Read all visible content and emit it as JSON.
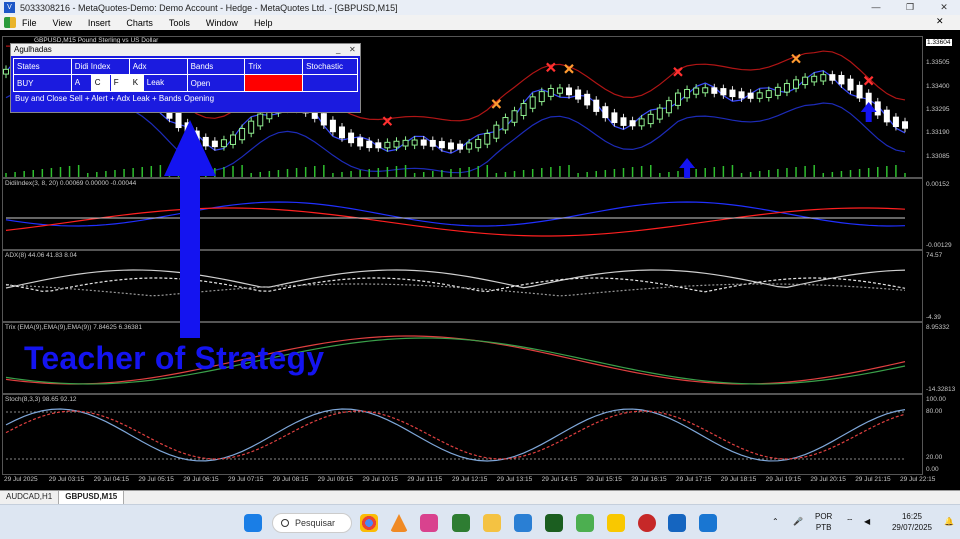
{
  "window": {
    "title": "5033308216 - MetaQuotes-Demo: Demo Account - Hedge - MetaQuotes Ltd. - [GBPUSD,M15]"
  },
  "menu": [
    "File",
    "View",
    "Insert",
    "Charts",
    "Tools",
    "Window",
    "Help"
  ],
  "panel": {
    "title": "Agulhadas",
    "headers": [
      "States",
      "Didi Index",
      "Adx",
      "Bands",
      "Trix",
      "Stochastic"
    ],
    "row": {
      "state": "BUY",
      "didi": [
        "A",
        "C",
        "F"
      ],
      "adx": [
        "K",
        "Leak"
      ],
      "bands": "Open",
      "trix_color": "#ff0000"
    },
    "footer": "Buy and Close Sell + Alert + Adx Leak + Bands Opening"
  },
  "chart_header": "GBPUSD,M15  Pound Sterling vs US Dollar",
  "price_scale": [
    "1.33604",
    "1.33505",
    "1.33400",
    "1.33295",
    "1.33190",
    "1.33085"
  ],
  "current_price": "1.33604",
  "indicators": {
    "didi": {
      "label": "DidiIndex(3, 8, 20) 0.00069 0.00000 -0.00044",
      "max": "0.00152",
      "min": "-0.00129"
    },
    "adx": {
      "label": "ADX(8) 44.06 41.83 8.04",
      "max": "74.57",
      "min": "-4.39"
    },
    "trix": {
      "label": "Trix (EMA(9),EMA(9),EMA(9)) 7.84625 6.36381",
      "max": "8.95332",
      "min": "-14.32813"
    },
    "stoch": {
      "label": "Stoch(8,3,3) 98.65 92.12",
      "levels": [
        "100.00",
        "80.00",
        "20.00",
        "0.00"
      ]
    }
  },
  "time_axis": [
    "29 Jul 2025",
    "29 Jul 03:15",
    "29 Jul 04:15",
    "29 Jul 05:15",
    "29 Jul 06:15",
    "29 Jul 07:15",
    "29 Jul 08:15",
    "29 Jul 09:15",
    "29 Jul 10:15",
    "29 Jul 11:15",
    "29 Jul 12:15",
    "29 Jul 13:15",
    "29 Jul 14:15",
    "29 Jul 15:15",
    "29 Jul 16:15",
    "29 Jul 17:15",
    "29 Jul 18:15",
    "29 Jul 19:15",
    "29 Jul 20:15",
    "29 Jul 21:15",
    "29 Jul 22:15"
  ],
  "tabs": [
    "AUDCAD,H1",
    "GBPUSD,M15"
  ],
  "overlay_text": "Teacher of Strategy",
  "taskbar": {
    "search": "Pesquisar",
    "lang": [
      "POR",
      "PTB"
    ],
    "time": "16:25",
    "date": "29/07/2025"
  },
  "colors": {
    "bull_candle": "#90ee90",
    "bear_candle": "#ffffff",
    "band_upper": "#b01515",
    "band_lower": "#1d2bb8",
    "didi_red": "#ff2020",
    "didi_blue": "#2030ff",
    "arrow_blue": "#1414f0"
  }
}
